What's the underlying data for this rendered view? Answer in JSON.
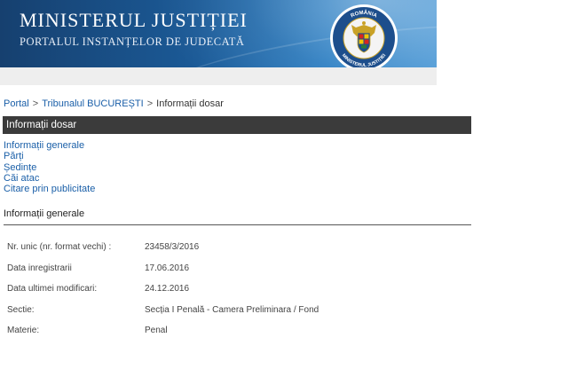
{
  "header": {
    "title": "MINISTERUL JUSTIȚIEI",
    "subtitle": "PORTALUL INSTANȚELOR DE JUDECATĂ",
    "emblem_top_text": "ROMÂNIA",
    "emblem_bottom_text": "MINISTERUL JUSTIȚIEI",
    "colors": {
      "banner": "#1b5a97",
      "emblem_ring": "#1d4e8c"
    }
  },
  "breadcrumb": {
    "items": [
      "Portal",
      "Tribunalul BUCUREȘTI",
      "Informații dosar"
    ],
    "separator": ">"
  },
  "section": {
    "title": "Informații dosar"
  },
  "nav_links": [
    "Informații generale",
    "Părți",
    "Ședințe",
    "Căi atac",
    "Citare prin publicitate"
  ],
  "general": {
    "heading": "Informații generale",
    "rows": [
      {
        "label": "Nr. unic (nr. format vechi) :",
        "value": "23458/3/2016"
      },
      {
        "label": "Data inregistrarii",
        "value": "17.06.2016"
      },
      {
        "label": "Data ultimei modificari:",
        "value": "24.12.2016"
      },
      {
        "label": "Sectie:",
        "value": "Secția I Penală - Camera Preliminara / Fond"
      },
      {
        "label": "Materie:",
        "value": "Penal"
      }
    ]
  }
}
